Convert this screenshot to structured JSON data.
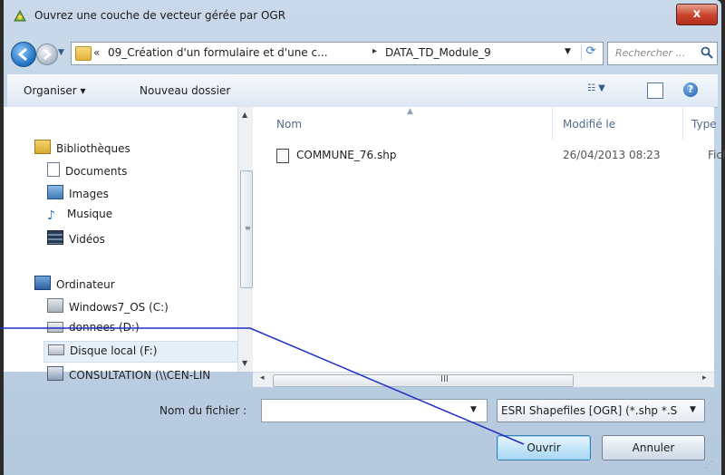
{
  "window": {
    "title": "Ouvrez une couche de vecteur gérée par OGR",
    "close_label": "x"
  },
  "address": {
    "overflow": "«",
    "crumbs": [
      "09_Création d'un formulaire et d'une c...",
      "DATA_TD_Module_9"
    ],
    "separator": "▸"
  },
  "search": {
    "placeholder": "Rechercher ..."
  },
  "toolbar": {
    "organize_label": "Organiser ▾",
    "new_folder_label": "Nouveau dossier",
    "help_label": "?"
  },
  "nav": {
    "libraries": {
      "label": "Bibliothèques",
      "items": [
        "Documents",
        "Images",
        "Musique",
        "Vidéos"
      ]
    },
    "computer": {
      "label": "Ordinateur",
      "items": [
        "Windows7_OS (C:)",
        "donnees (D:)",
        "Disque local (F:)",
        "CONSULTATION (\\\\CEN-LIN"
      ]
    }
  },
  "columns": {
    "name": "Nom",
    "modified": "Modifié le",
    "type": "Type"
  },
  "files": [
    {
      "name": "COMMUNE_76.shp",
      "modified": "26/04/2013 08:23",
      "type": "Fichi"
    }
  ],
  "bottom": {
    "filename_label": "Nom du fichier :",
    "filename_value": "",
    "filter_value": "ESRI Shapefiles [OGR] (*.shp *.S",
    "open_label": "Ouvrir",
    "cancel_label": "Annuler"
  },
  "colors": {
    "accent": "#1d6fc2",
    "callout_line": "#1f2fc8",
    "close_red": "#c8412a"
  }
}
